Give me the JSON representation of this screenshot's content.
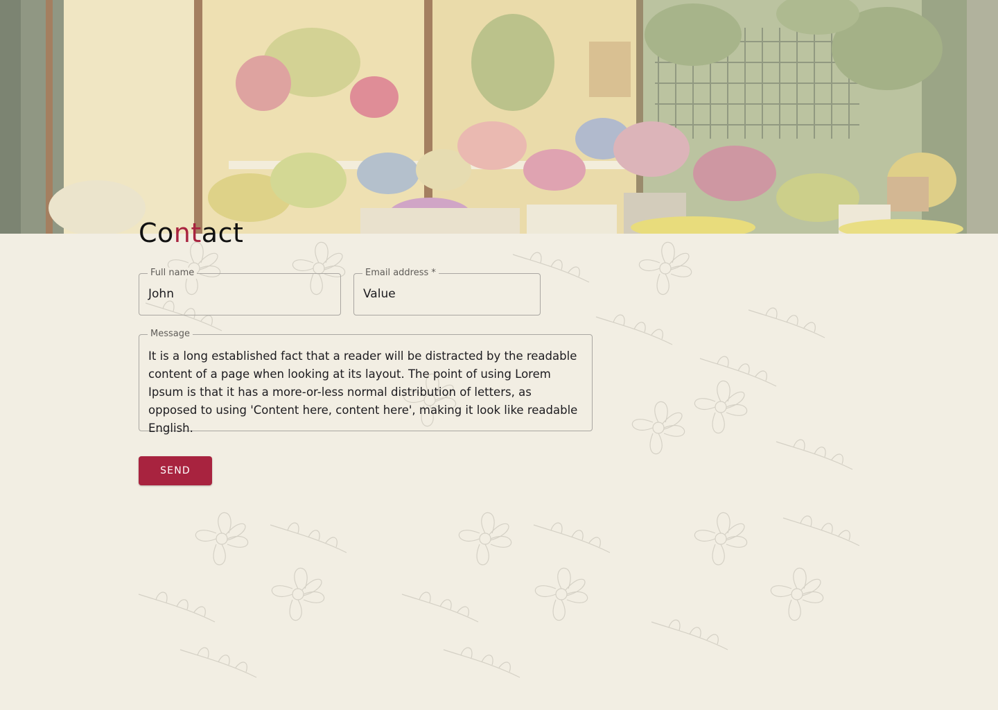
{
  "hero": {
    "alt_icon": "flower-shop-storefront-image"
  },
  "contact": {
    "title_parts": [
      "Co",
      "nt",
      "act"
    ],
    "accent_color": "#a8233f"
  },
  "form": {
    "full_name": {
      "label": "Full name",
      "value": "John"
    },
    "email": {
      "label": "Email address *",
      "value": "Value"
    },
    "message": {
      "label": "Message",
      "value": "It is a long established fact that a reader will be distracted by the readable content of a page when looking at its layout. The point of using Lorem Ipsum is that it has a more-or-less normal distribution of letters, as opposed to using 'Content here, content here', making it look like readable English."
    },
    "send_label": "SEND"
  },
  "colors": {
    "background": "#f2eee3",
    "button": "#a8233f"
  }
}
